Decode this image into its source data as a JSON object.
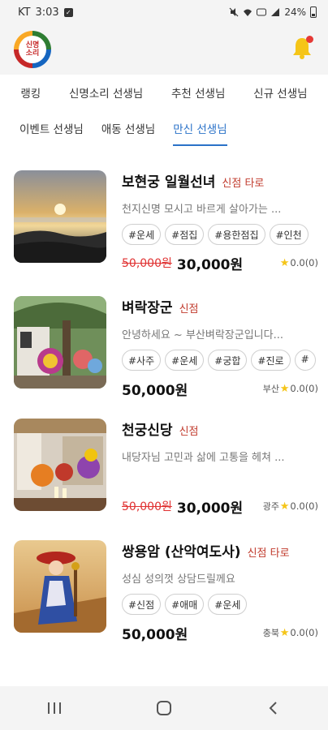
{
  "status_bar": {
    "carrier": "KT",
    "time": "3:03",
    "battery_percent": "24%"
  },
  "header": {
    "logo_text_line1": "신명",
    "logo_text_line2": "소리"
  },
  "tabs_row1": [
    "랭킹",
    "신명소리 선생님",
    "추천 선생님",
    "신규 선생님"
  ],
  "tabs_row2": [
    "이벤트 선생님",
    "애동 선생님",
    "만신 선생님"
  ],
  "active_tab": "만신 선생님",
  "listings": [
    {
      "name": "보현궁 일월선녀",
      "badge": "신점 타로",
      "description": "천지신명 모시고 바르게 살아가는 ...",
      "tags": [
        "#운세",
        "#점집",
        "#용한점집",
        "#인천"
      ],
      "old_price": "50,000원",
      "price": "30,000원",
      "region": "",
      "rating": "0.0(0)"
    },
    {
      "name": "벼락장군",
      "badge": "신점",
      "description": "안녕하세요 ~ 부산벼락장군입니다...",
      "tags": [
        "#사주",
        "#운세",
        "#궁합",
        "#진로",
        "#"
      ],
      "old_price": "",
      "price": "50,000원",
      "region": "부산",
      "rating": "0.0(0)"
    },
    {
      "name": "천궁신당",
      "badge": "신점",
      "description": "내당자님 고민과 삶에 고통을 헤쳐 ...",
      "tags": [],
      "old_price": "50,000원",
      "price": "30,000원",
      "region": "광주",
      "rating": "0.0(0)"
    },
    {
      "name": "쌍용암 (산악여도사)",
      "badge": "신점 타로",
      "description": "성심 성의껏 상담드릴께요",
      "tags": [
        "#신점",
        "#애매",
        "#운세"
      ],
      "old_price": "",
      "price": "50,000원",
      "region": "충북",
      "rating": "0.0(0)"
    }
  ],
  "colors": {
    "accent": "#2a72c8",
    "badge": "#c0392b",
    "strike_price": "#e03131",
    "star": "#f5c518",
    "bell": "#f5c518"
  }
}
